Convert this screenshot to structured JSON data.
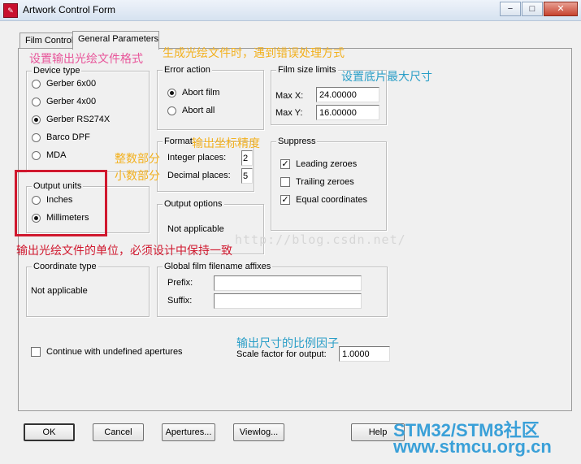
{
  "window": {
    "title": "Artwork Control Form",
    "buttons": {
      "minimize": "−",
      "maximize": "□",
      "close": "✕"
    }
  },
  "tabs": [
    {
      "label": "Film Control"
    },
    {
      "label": "General Parameters"
    }
  ],
  "device_type": {
    "title": "Device type",
    "options": [
      "Gerber 6x00",
      "Gerber 4x00",
      "Gerber RS274X",
      "Barco DPF",
      "MDA"
    ],
    "selected": "Gerber RS274X"
  },
  "output_units": {
    "title": "Output units",
    "options": [
      "Inches",
      "Millimeters"
    ],
    "selected": "Millimeters"
  },
  "coordinate_type": {
    "title": "Coordinate type",
    "text": "Not applicable"
  },
  "error_action": {
    "title": "Error action",
    "options": [
      "Abort film",
      "Abort all"
    ],
    "selected": "Abort film"
  },
  "format": {
    "title": "Format",
    "integer_label": "Integer places:",
    "integer_value": "2",
    "decimal_label": "Decimal places:",
    "decimal_value": "5"
  },
  "output_options": {
    "title": "Output options",
    "text": "Not applicable"
  },
  "film_size": {
    "title": "Film size limits",
    "max_x_label": "Max X:",
    "max_x": "24.00000",
    "max_y_label": "Max Y:",
    "max_y": "16.00000"
  },
  "suppress": {
    "title": "Suppress",
    "items": [
      {
        "label": "Leading zeroes",
        "checked": true
      },
      {
        "label": "Trailing zeroes",
        "checked": false
      },
      {
        "label": "Equal coordinates",
        "checked": true
      }
    ]
  },
  "affixes": {
    "title": "Global film filename affixes",
    "prefix_label": "Prefix:",
    "prefix_value": "",
    "suffix_label": "Suffix:",
    "suffix_value": ""
  },
  "continue_undefined": {
    "label": "Continue with undefined apertures",
    "checked": false
  },
  "scale": {
    "label": "Scale factor for output:",
    "value": "1.0000"
  },
  "bottom_buttons": {
    "ok": "OK",
    "cancel": "Cancel",
    "apertures": "Apertures...",
    "viewlog": "Viewlog...",
    "help": "Help"
  },
  "annotations": {
    "set_format": "设置输出光绘文件格式",
    "error_handling": "生成光绘文件时，遇到错误处理方式",
    "film_size": "设置底片最大尺寸",
    "coord_precision": "输出坐标精度",
    "integer_part": "整数部分",
    "decimal_part": "小数部分",
    "units_note": "输出光绘文件的单位，必须设计中保持一致",
    "scale_note": "输出尺寸的比例因子"
  },
  "watermark": "http://blog.csdn.net/",
  "brand": {
    "line1": "STM32/STM8社区",
    "line2": "www.stmcu.org.cn"
  },
  "colors": {
    "annotation_pink": "#e8559a",
    "annotation_yellow": "#f2b01d",
    "annotation_teal": "#2a9ec7",
    "annotation_red": "#d0182e",
    "brand_blue": "#3aa0d8"
  }
}
